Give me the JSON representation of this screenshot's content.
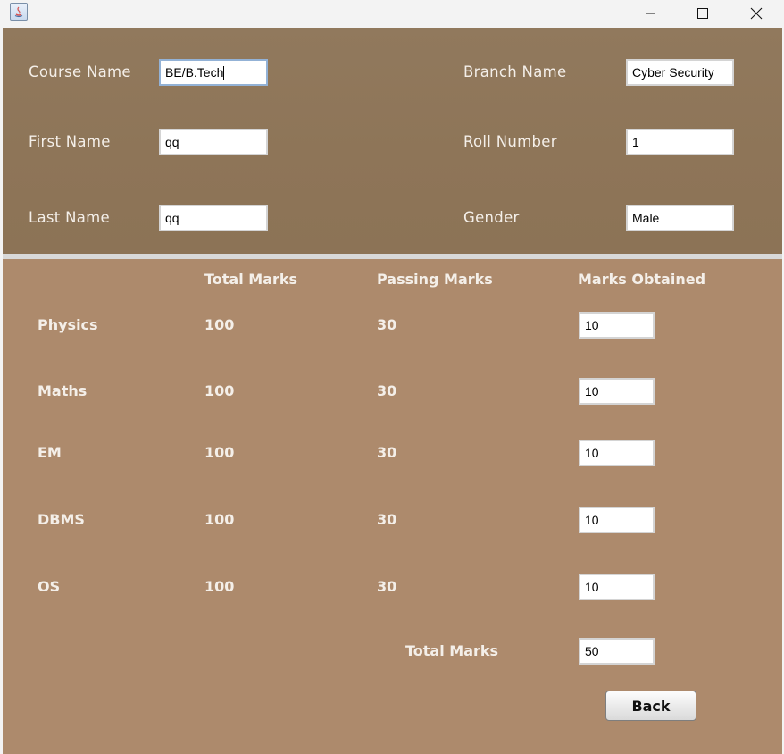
{
  "window": {
    "controls": [
      "minimize",
      "maximize",
      "close"
    ]
  },
  "student": {
    "course_name_label": "Course Name",
    "course_name_value": "BE/B.Tech",
    "branch_name_label": "Branch Name",
    "branch_name_value": "Cyber Security",
    "first_name_label": "First Name",
    "first_name_value": "qq",
    "roll_number_label": "Roll Number",
    "roll_number_value": "1",
    "last_name_label": "Last Name",
    "last_name_value": "qq",
    "gender_label": "Gender",
    "gender_value": "Male"
  },
  "marks": {
    "headers": {
      "total_marks": "Total Marks",
      "passing_marks": "Passing Marks",
      "marks_obtained": "Marks Obtained"
    },
    "subjects": [
      {
        "name": "Physics",
        "total": "100",
        "passing": "30",
        "obtained": "10"
      },
      {
        "name": "Maths",
        "total": "100",
        "passing": "30",
        "obtained": "10"
      },
      {
        "name": "EM",
        "total": "100",
        "passing": "30",
        "obtained": "10"
      },
      {
        "name": "DBMS",
        "total": "100",
        "passing": "30",
        "obtained": "10"
      },
      {
        "name": "OS",
        "total": "100",
        "passing": "30",
        "obtained": "10"
      }
    ],
    "total_label": "Total Marks",
    "total_value": "50"
  },
  "actions": {
    "back_label": "Back"
  },
  "colors": {
    "top_panel": "#8e7558",
    "bottom_panel": "#ad8a6c",
    "divider": "#d8d8d8",
    "label_text": "#f4efe9"
  }
}
